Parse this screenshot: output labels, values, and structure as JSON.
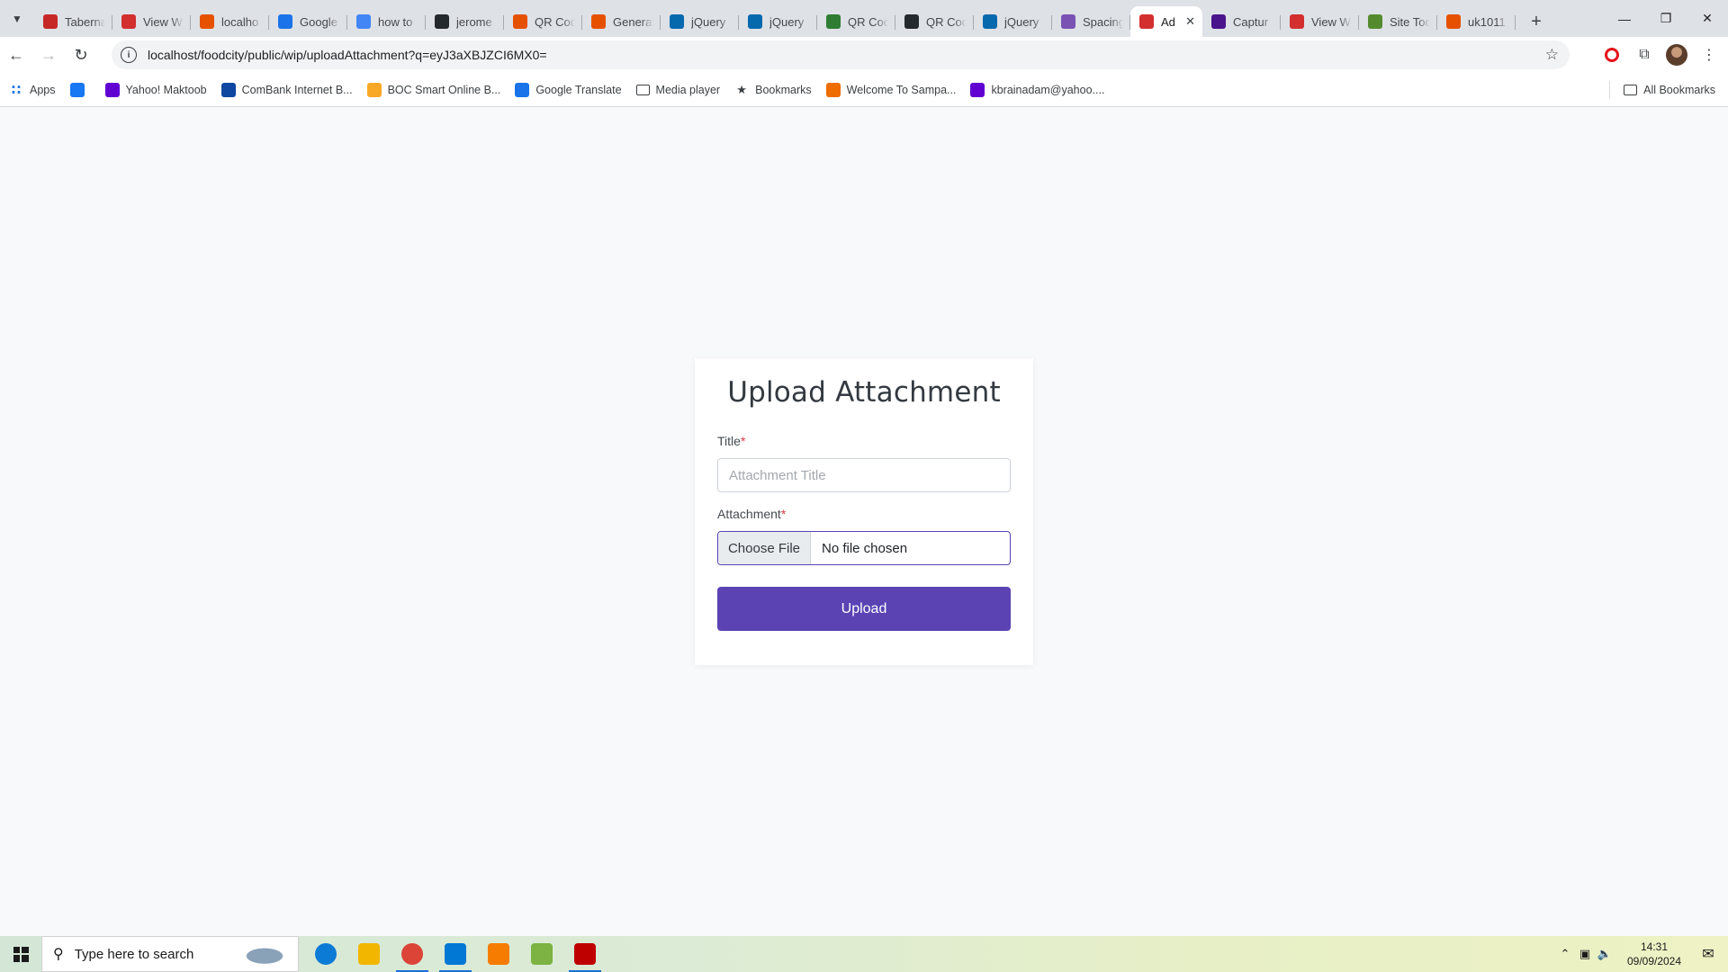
{
  "browser": {
    "tabs": [
      {
        "label": "Taberna",
        "favicon": "candy-icon",
        "color": "#c62828"
      },
      {
        "label": "View W",
        "favicon": "bowl-icon",
        "color": "#d32f2f"
      },
      {
        "label": "localho",
        "favicon": "wave-icon",
        "color": "#e65100"
      },
      {
        "label": "Google",
        "favicon": "translate-icon",
        "color": "#1a73e8"
      },
      {
        "label": "how to",
        "favicon": "google-icon",
        "color": "#4285f4"
      },
      {
        "label": "jerome",
        "favicon": "github-icon",
        "color": "#24292e"
      },
      {
        "label": "QR Cod",
        "favicon": "flame-icon",
        "color": "#e65100"
      },
      {
        "label": "Generat",
        "favicon": "flame-icon",
        "color": "#e65100"
      },
      {
        "label": "jQuery",
        "favicon": "jquery-icon",
        "color": "#0769ad"
      },
      {
        "label": "jQuery",
        "favicon": "jquery-icon",
        "color": "#0769ad"
      },
      {
        "label": "QR Coc",
        "favicon": "link-icon",
        "color": "#2e7d32"
      },
      {
        "label": "QR Coc",
        "favicon": "github-icon",
        "color": "#24292e"
      },
      {
        "label": "jQuery",
        "favicon": "jquery-icon",
        "color": "#0769ad"
      },
      {
        "label": "Spacing",
        "favicon": "bootstrap-icon",
        "color": "#7952b3"
      },
      {
        "label": "Ad",
        "favicon": "bowl-icon",
        "color": "#d32f2f",
        "active": true
      },
      {
        "label": "Captur",
        "favicon": "capture-icon",
        "color": "#4a148c"
      },
      {
        "label": "View W",
        "favicon": "bowl-icon",
        "color": "#d32f2f"
      },
      {
        "label": "Site Toc",
        "favicon": "dot-icon",
        "color": "#558b2f"
      },
      {
        "label": "uk1011",
        "favicon": "wave-icon",
        "color": "#e65100"
      }
    ],
    "url": "localhost/foodcity/public/wip/uploadAttachment?q=eyJ3aXBJZCI6MX0=",
    "bookmarks": [
      {
        "label": "Apps",
        "icon": "apps-grid-icon",
        "color": "#1a73e8"
      },
      {
        "label": "",
        "icon": "facebook-icon",
        "color": "#1877f2"
      },
      {
        "label": "Yahoo! Maktoob",
        "icon": "yahoo-icon",
        "color": "#6001d2"
      },
      {
        "label": "ComBank Internet B...",
        "icon": "combank-icon",
        "color": "#0d47a1"
      },
      {
        "label": "BOC Smart Online B...",
        "icon": "boc-icon",
        "color": "#f9a825"
      },
      {
        "label": "Google Translate",
        "icon": "translate-icon",
        "color": "#1a73e8"
      },
      {
        "label": "Media player",
        "icon": "folder-icon",
        "color": "#3c4043"
      },
      {
        "label": "Bookmarks",
        "icon": "star-icon",
        "color": "#3c4043"
      },
      {
        "label": "Welcome To Sampa...",
        "icon": "sampath-icon",
        "color": "#ef6c00"
      },
      {
        "label": "kbrainadam@yahoo....",
        "icon": "mail-icon",
        "color": "#6001d2"
      }
    ],
    "all_bookmarks_label": "All Bookmarks"
  },
  "form": {
    "heading": "Upload Attachment",
    "title_label": "Title",
    "title_required": "*",
    "title_placeholder": "Attachment Title",
    "title_value": "",
    "attachment_label": "Attachment",
    "attachment_required": "*",
    "choose_file_label": "Choose File",
    "file_status": "No file chosen",
    "upload_label": "Upload",
    "accent_color": "#5b43b4"
  },
  "taskbar": {
    "search_placeholder": "Type here to search",
    "apps": [
      {
        "name": "edge-icon",
        "color": "#0c7bd6",
        "running": false
      },
      {
        "name": "file-explorer-icon",
        "color": "#f2b600",
        "running": false
      },
      {
        "name": "chrome-icon",
        "color": "#db4437",
        "running": true
      },
      {
        "name": "vscode-icon",
        "color": "#0078d4",
        "running": true
      },
      {
        "name": "xampp-icon",
        "color": "#f57c00",
        "running": false
      },
      {
        "name": "notepadpp-icon",
        "color": "#7cb342",
        "running": false
      },
      {
        "name": "filezilla-icon",
        "color": "#bf0000",
        "running": true
      }
    ],
    "time": "14:31",
    "date": "09/09/2024",
    "notification_count": "1"
  }
}
